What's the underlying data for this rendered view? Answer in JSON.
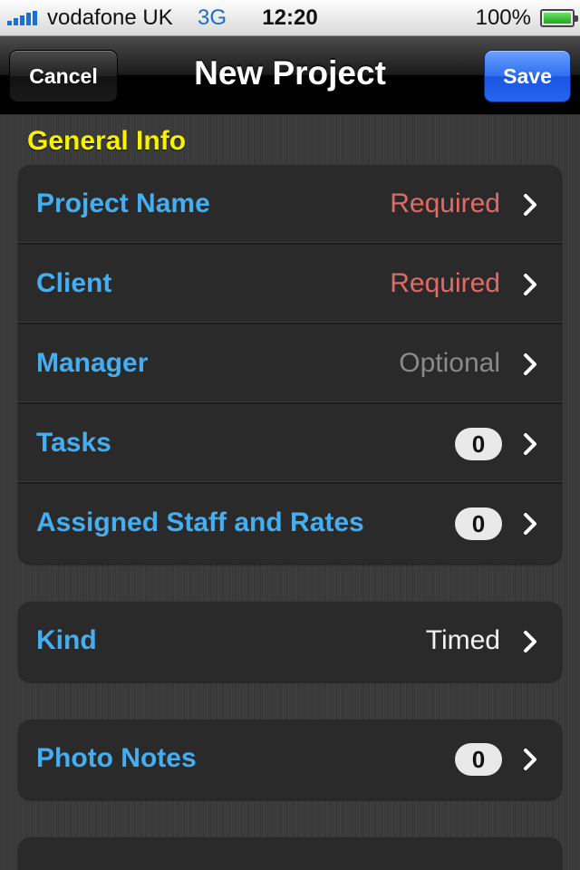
{
  "status_bar": {
    "carrier": "vodafone UK",
    "network": "3G",
    "time": "12:20",
    "battery": "100%"
  },
  "nav": {
    "title": "New Project",
    "cancel_label": "Cancel",
    "save_label": "Save"
  },
  "general_info": {
    "header": "General Info",
    "rows": [
      {
        "label": "Project Name",
        "value": "Required"
      },
      {
        "label": "Client",
        "value": "Required"
      },
      {
        "label": "Manager",
        "value": "Optional"
      },
      {
        "label": "Tasks",
        "badge": "0"
      },
      {
        "label": "Assigned Staff and Rates",
        "badge": "0"
      }
    ]
  },
  "kind_group": {
    "label": "Kind",
    "value": "Timed"
  },
  "photo_group": {
    "label": "Photo Notes",
    "badge": "0"
  },
  "colors": {
    "accent_label": "#45aef0",
    "required": "#e06a66",
    "section_header": "#f7f200",
    "save_button": "#2f6fef"
  },
  "icons": [
    "signal-icon",
    "battery-icon",
    "chevron-right-icon"
  ]
}
